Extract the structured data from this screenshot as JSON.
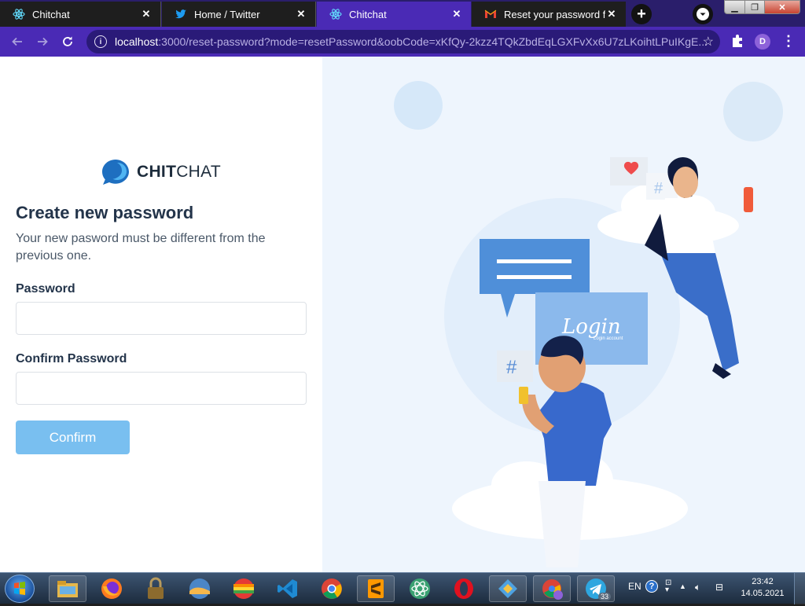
{
  "browser": {
    "tabs": [
      {
        "title": "Chitchat",
        "icon": "react-icon",
        "active": false
      },
      {
        "title": "Home / Twitter",
        "icon": "twitter-icon",
        "active": false
      },
      {
        "title": "Chitchat",
        "icon": "react-icon",
        "active": true
      },
      {
        "title": "Reset your password for",
        "icon": "gmail-icon",
        "active": false
      }
    ],
    "address": {
      "host": "localhost",
      "rest": ":3000/reset-password?mode=resetPassword&oobCode=xKfQy-2kzz4TQkZbdEqLGXFvXx6U7zLKoihtLPuIKgE..."
    },
    "profile_initial": "D"
  },
  "page": {
    "logo": {
      "bold": "CHIT",
      "regular": "CHAT"
    },
    "heading": "Create new password",
    "subtext": "Your new pasword must be different from the previous one.",
    "password_label": "Password",
    "password_value": "",
    "confirm_label": "Confirm Password",
    "confirm_value": "",
    "confirm_button": "Confirm",
    "illustration": {
      "card_title": "Login",
      "card_subtitle": "Login account",
      "hash": "#"
    },
    "colors": {
      "accent": "#79bff0",
      "heading": "#23344a",
      "panel": "#eef5fd"
    }
  },
  "taskbar": {
    "language": "EN",
    "time": "23:42",
    "date": "14.05.2021",
    "telegram_badge": "33"
  }
}
